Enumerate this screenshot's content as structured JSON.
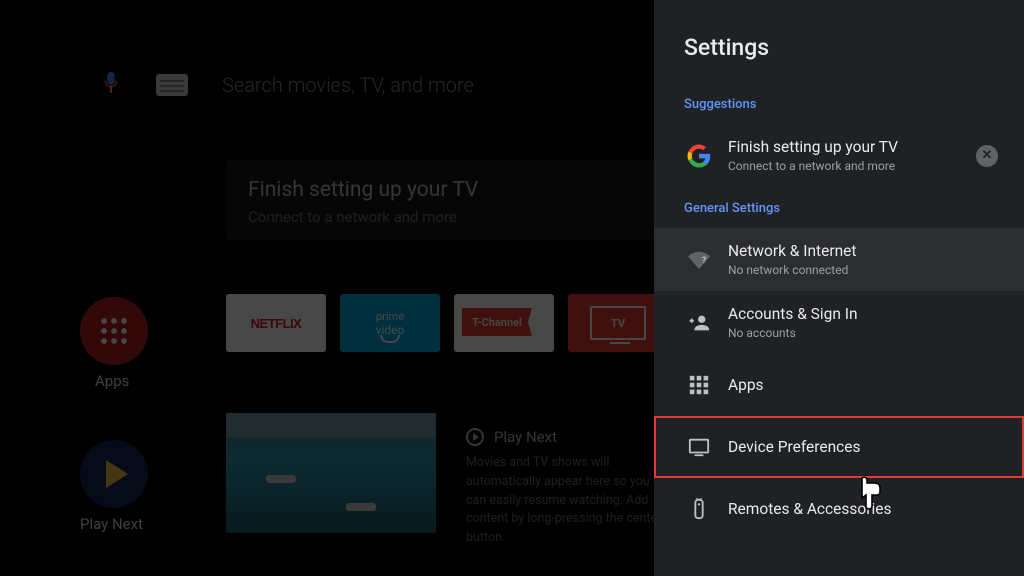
{
  "search": {
    "placeholder": "Search movies, TV, and more"
  },
  "home": {
    "setup_card": {
      "title": "Finish setting up your TV",
      "subtitle": "Connect to a network and more"
    },
    "apps_button_label": "Apps",
    "app_tiles": {
      "netflix": "NETFLIX",
      "prime_line1": "prime",
      "prime_line2": "video",
      "tchannel": "T-Channel",
      "tv": "TV"
    },
    "play_next_button_label": "Play Next",
    "play_next": {
      "header": "Play Next",
      "body": "Movies and TV shows will automatically appear here so you can easily resume watching. Add content by long-pressing the center button."
    }
  },
  "settings": {
    "title": "Settings",
    "sections": {
      "suggestions_header": "Suggestions",
      "general_header": "General Settings"
    },
    "suggestion": {
      "title": "Finish setting up your TV",
      "subtitle": "Connect to a network and more"
    },
    "items": [
      {
        "title": "Network & Internet",
        "subtitle": "No network connected"
      },
      {
        "title": "Accounts & Sign In",
        "subtitle": "No accounts"
      },
      {
        "title": "Apps",
        "subtitle": ""
      },
      {
        "title": "Device Preferences",
        "subtitle": ""
      },
      {
        "title": "Remotes & Accessories",
        "subtitle": ""
      }
    ]
  }
}
